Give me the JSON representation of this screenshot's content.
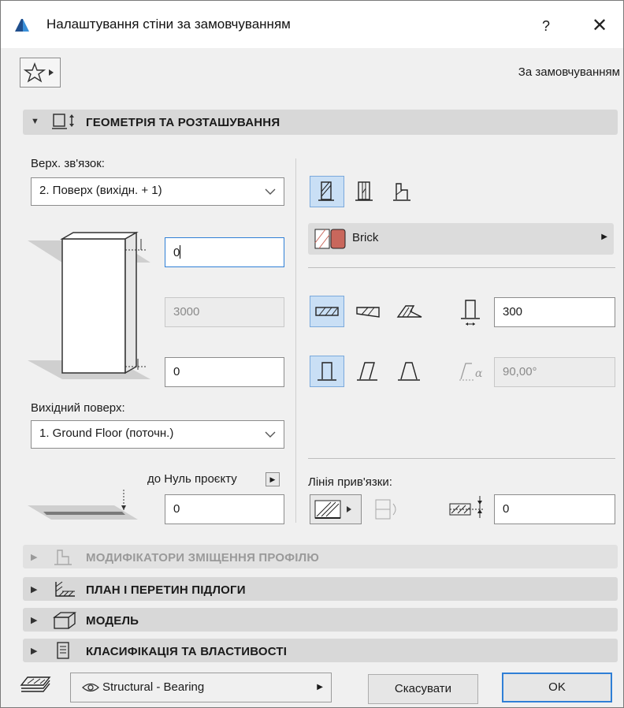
{
  "window": {
    "title": "Налаштування стіни за замовчуванням",
    "help_label": "?",
    "close_label": "✕"
  },
  "toolbar": {
    "preset_label": "За замовчуванням"
  },
  "sections": {
    "geometry": "ГЕОМЕТРІЯ ТА РОЗТАШУВАННЯ",
    "profile_modifiers": "МОДИФІКАТОРИ ЗМІЩЕННЯ ПРОФІЛЮ",
    "floor_plan": "ПЛАН І ПЕРЕТИН ПІДЛОГИ",
    "model": "МОДЕЛЬ",
    "classification": "КЛАСИФІКАЦІЯ ТА ВЛАСТИВОСТІ"
  },
  "geometry": {
    "top_link_label": "Верх. зв'язок:",
    "top_link_value": "2. Поверх (вихідн. + 1)",
    "top_offset": "0",
    "height": "3000",
    "bottom_offset": "0",
    "home_story_label": "Вихідний поверх:",
    "home_story_value": "1. Ground Floor (поточн.)",
    "reference_label": "до Нуль проєкту",
    "reference_value": "0",
    "building_material": "Brick",
    "thickness": "300",
    "slant_angle": "90,00°",
    "ref_line_label": "Лінія прив'язки:",
    "ref_line_offset": "0"
  },
  "footer": {
    "layer_name": "Structural - Bearing",
    "cancel_label": "Скасувати",
    "ok_label": "OK"
  },
  "colors": {
    "accent": "#2f7fd6",
    "selected_bg": "#c9dff5",
    "brick": "#c9675c"
  }
}
